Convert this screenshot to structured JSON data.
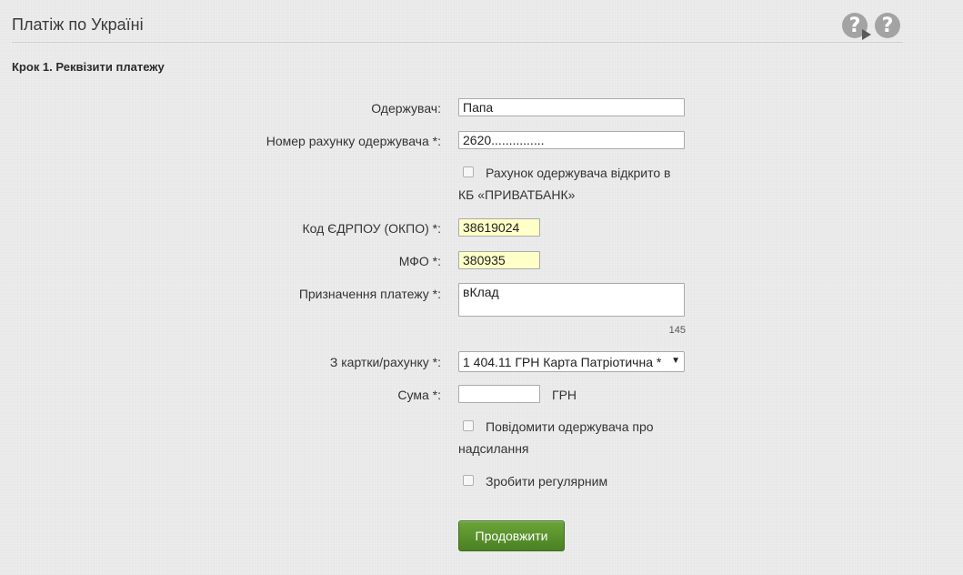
{
  "header": {
    "title": "Платіж по Україні"
  },
  "step_title": "Крок 1. Реквізити платежу",
  "form": {
    "recipient_label": "Одержувач:",
    "recipient_value": "Папа",
    "account_label": "Номер рахунку одержувача *:",
    "account_value": "2620...............",
    "privatbank_checkbox_label": "Рахунок одержувача відкрито в КБ «ПРИВАТБАНК»",
    "edrpou_label": "Код ЄДРПОУ (ОКПО) *:",
    "edrpou_value": "38619024",
    "mfo_label": "МФО *:",
    "mfo_value": "380935",
    "purpose_label": "Призначення платежу *:",
    "purpose_value": "вКлад",
    "purpose_counter": "145",
    "card_label": "З картки/рахунку *:",
    "card_selected": "1 404.11 ГРН  Карта Патріотична *",
    "amount_label": "Сума *:",
    "amount_value": "",
    "currency": "ГРН",
    "notify_checkbox_label": "Повідомити одержувача про надсилання",
    "regular_checkbox_label": "Зробити регулярним",
    "continue_button": "Продовжити"
  },
  "colors": {
    "highlight_field": "#ffffc8",
    "button_green": "#4b8023",
    "background": "#ececec"
  },
  "icons": {
    "help_video": "help-video-icon",
    "help": "help-icon"
  }
}
